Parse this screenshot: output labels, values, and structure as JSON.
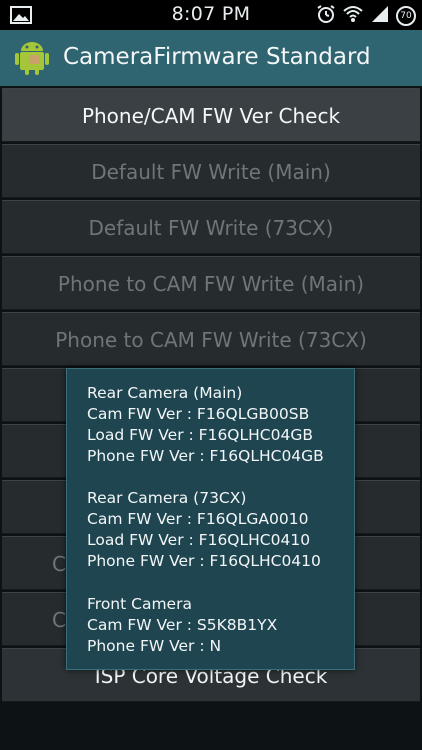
{
  "status_bar": {
    "time": "8:07 PM",
    "battery": "70",
    "icons": [
      "image-icon",
      "alarm-icon",
      "wifi-icon",
      "signal-icon",
      "battery-icon"
    ]
  },
  "action_bar": {
    "title": "CameraFirmware Standard",
    "icon": "android-icon"
  },
  "buttons": [
    {
      "label": "Phone/CAM FW Ver Check"
    },
    {
      "label": "Default FW Write (Main)"
    },
    {
      "label": "Default FW Write (73CX)"
    },
    {
      "label": "Phone to CAM FW Write (Main)"
    },
    {
      "label": "Phone to CAM FW Write (73CX)"
    },
    {
      "label": "C"
    },
    {
      "label": "C"
    },
    {
      "label": "ISP Core Voltage Check"
    }
  ],
  "popup": {
    "rear_main": {
      "title": "Rear Camera (Main)",
      "cam_fw": "Cam FW Ver : F16QLGB00SB",
      "load_fw": "Load FW Ver : F16QLHC04GB",
      "phone_fw": "Phone FW Ver : F16QLHC04GB"
    },
    "rear_73cx": {
      "title": "Rear Camera (73CX)",
      "cam_fw": "Cam FW Ver : F16QLGA0010",
      "load_fw": "Load FW Ver : F16QLHC0410",
      "phone_fw": "Phone FW Ver : F16QLHC0410"
    },
    "front": {
      "title": "Front Camera",
      "cam_fw": "Cam FW Ver : S5K8B1YX",
      "phone_fw": "Phone FW Ver : N"
    }
  },
  "colors": {
    "action_bar": "#2f6471",
    "popup_bg": "#1e4550",
    "button_bg": "#262b2e"
  }
}
